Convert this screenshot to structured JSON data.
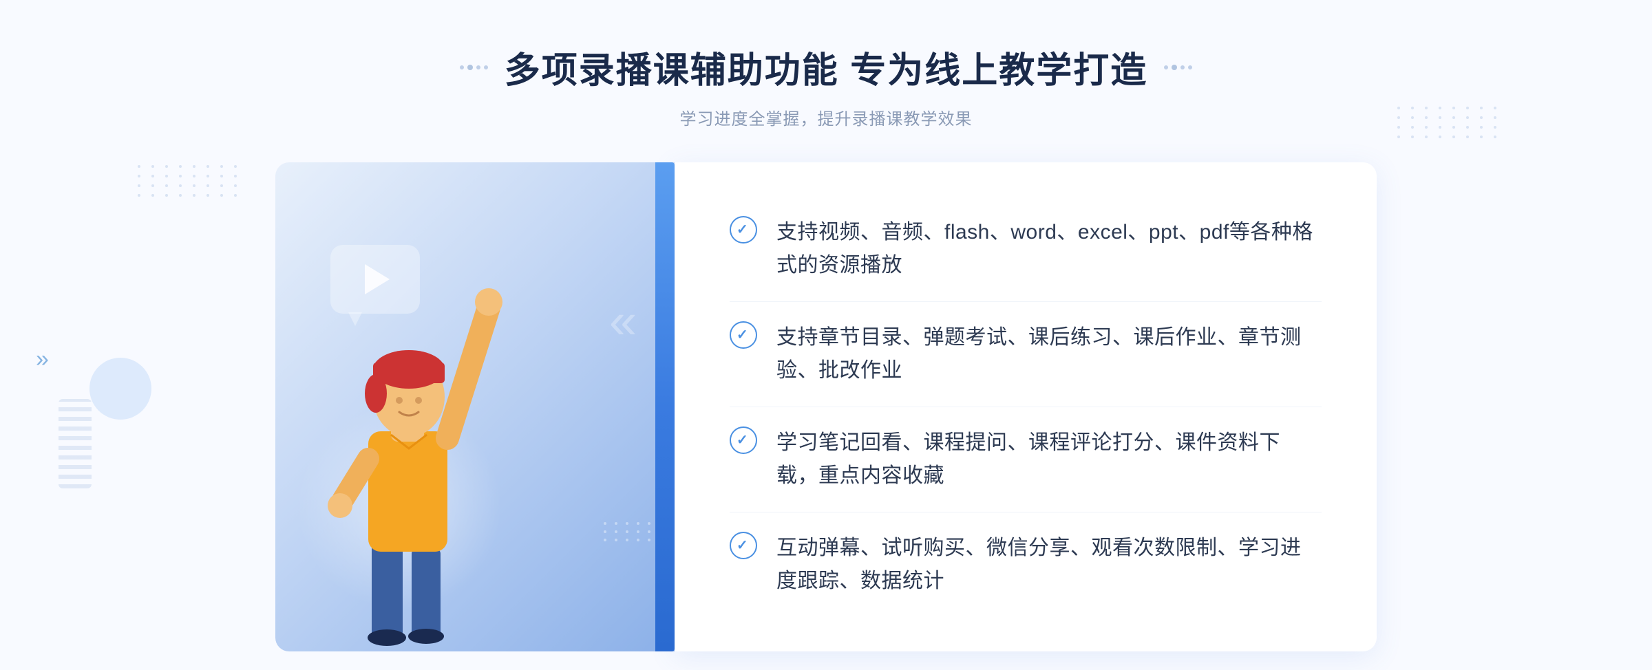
{
  "header": {
    "title": "多项录播课辅助功能 专为线上教学打造",
    "subtitle": "学习进度全掌握，提升录播课教学效果"
  },
  "features": [
    {
      "id": "feature-1",
      "text": "支持视频、音频、flash、word、excel、ppt、pdf等各种格式的资源播放"
    },
    {
      "id": "feature-2",
      "text": "支持章节目录、弹题考试、课后练习、课后作业、章节测验、批改作业"
    },
    {
      "id": "feature-3",
      "text": "学习笔记回看、课程提问、课程评论打分、课件资料下载，重点内容收藏"
    },
    {
      "id": "feature-4",
      "text": "互动弹幕、试听购买、微信分享、观看次数限制、学习进度跟踪、数据统计"
    }
  ],
  "colors": {
    "primary_blue": "#4a90e2",
    "title_color": "#1a2a4a",
    "text_color": "#2d3a52",
    "subtitle_color": "#8a9ab5",
    "bg_color": "#f8faff",
    "card_bg": "#ffffff"
  },
  "decorations": {
    "left_arrow": "»",
    "dot_label": "decorative-dots"
  }
}
